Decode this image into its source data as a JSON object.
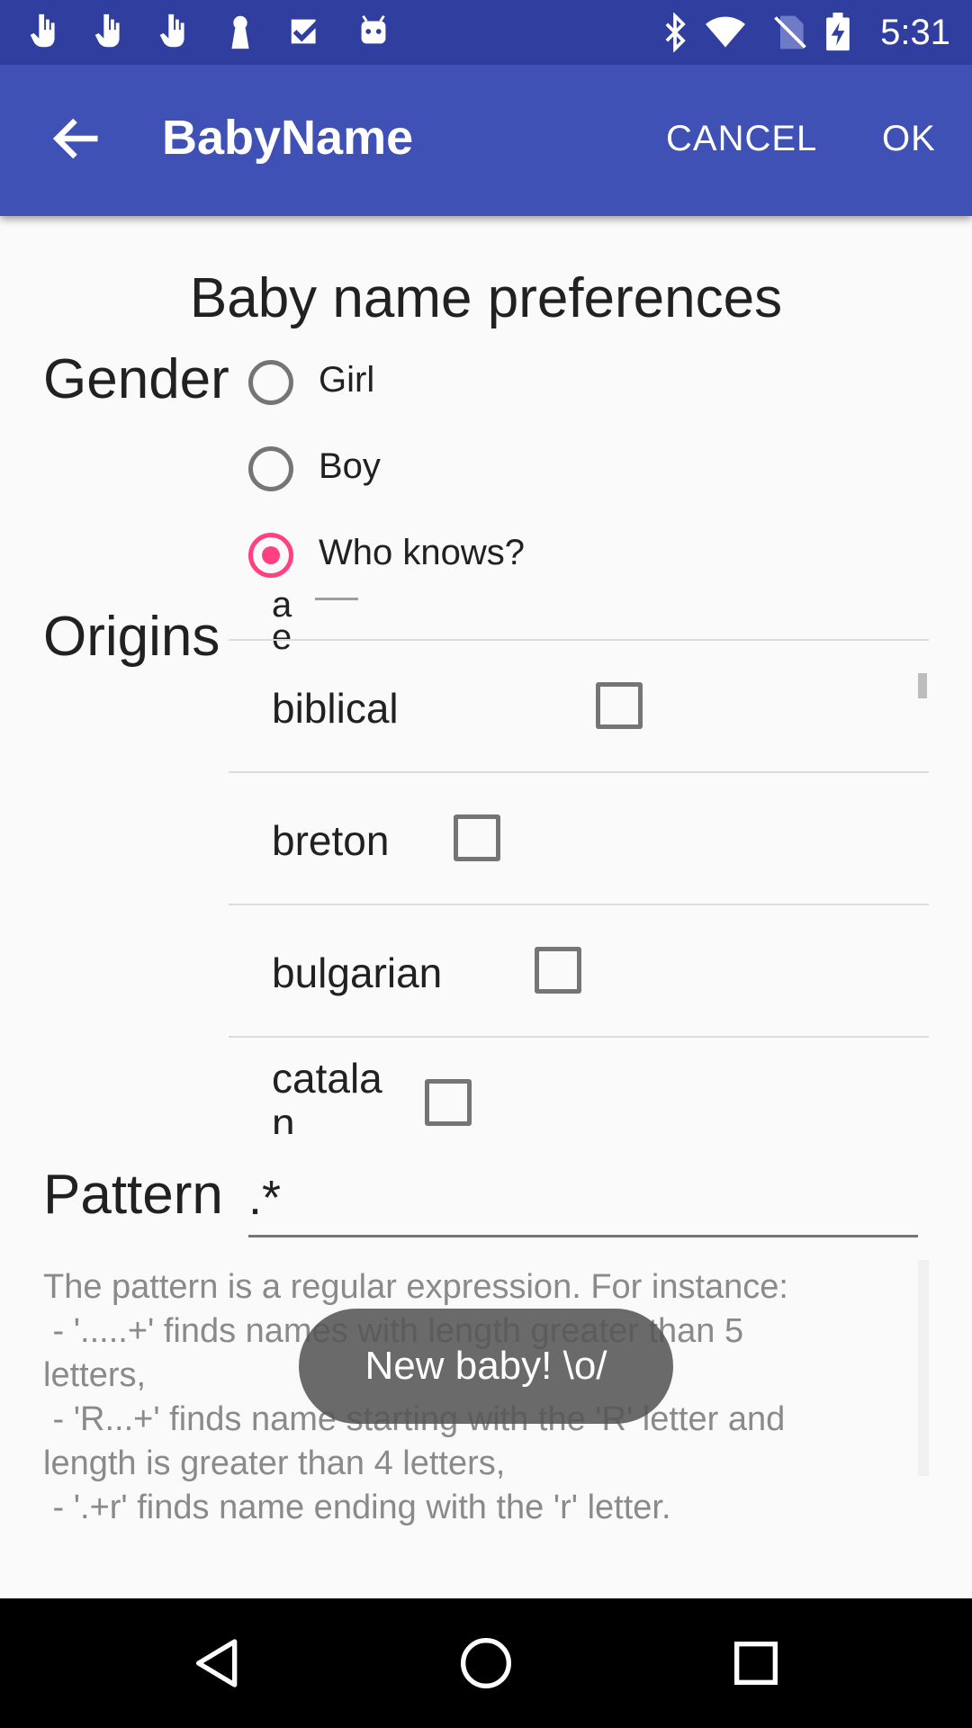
{
  "status_bar": {
    "time": "5:31",
    "notification_icons": [
      "hand-pointer-icon",
      "hand-pointer-icon",
      "hand-pointer-icon",
      "keyhole-icon",
      "checkbox-icon",
      "android-icon"
    ],
    "right_icons": [
      "bluetooth-icon",
      "wifi-icon",
      "no-sim-icon",
      "battery-charging-icon"
    ]
  },
  "app_bar": {
    "title": "BabyName",
    "cancel_label": "CANCEL",
    "ok_label": "OK",
    "back_icon": "arrow-back-icon",
    "color": "#3f51b5"
  },
  "form": {
    "heading": "Baby name preferences",
    "gender_label": "Gender",
    "gender_options": [
      {
        "label": "Girl",
        "checked": false
      },
      {
        "label": "Boy",
        "checked": false
      },
      {
        "label": "Who knows?",
        "checked": true
      }
    ],
    "origins_label": "Origins",
    "origins_partial_top": "a\ne",
    "origins": [
      {
        "label": "biblical",
        "checked": false
      },
      {
        "label": "breton",
        "checked": false
      },
      {
        "label": "bulgarian",
        "checked": false
      },
      {
        "label": "catala\nn",
        "checked": false
      }
    ],
    "pattern_label": "Pattern",
    "pattern_value": ".*",
    "pattern_help": "The pattern is a regular expression. For instance:\n - '.....+' finds names with length greater than 5\nletters,\n - 'R...+' finds name starting with the 'R' letter and\nlength is greater than 4 letters,\n - '.+r' finds name ending with the 'r' letter."
  },
  "toast": {
    "text": "New baby! \\o/"
  },
  "nav_bar": {
    "icons": [
      "back-triangle-icon",
      "home-circle-icon",
      "recents-square-icon"
    ]
  },
  "colors": {
    "accent": "#ff4081",
    "primary_dark": "#303f9f"
  }
}
